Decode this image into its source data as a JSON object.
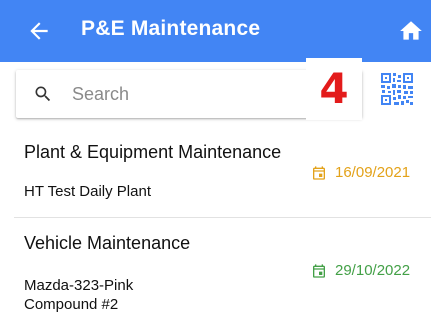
{
  "appbar": {
    "title": "P&E Maintenance",
    "color": "#4285F4",
    "back_icon": "arrow-left-icon",
    "home_icon": "home-icon"
  },
  "search": {
    "placeholder": "Search",
    "value": ""
  },
  "badge": {
    "text": "4",
    "color": "#e31b1b"
  },
  "qr": {
    "icon": "qr-code-icon",
    "color": "#4285F4"
  },
  "items": [
    {
      "title": "Plant & Equipment Maintenance",
      "subtitle": "HT Test Daily Plant",
      "date": "16/09/2021",
      "date_color": "#E3A21A"
    },
    {
      "title": "Vehicle Maintenance",
      "subtitle": "Mazda-323-Pink\nCompound #2",
      "date": "29/10/2022",
      "date_color": "#43A047"
    }
  ]
}
